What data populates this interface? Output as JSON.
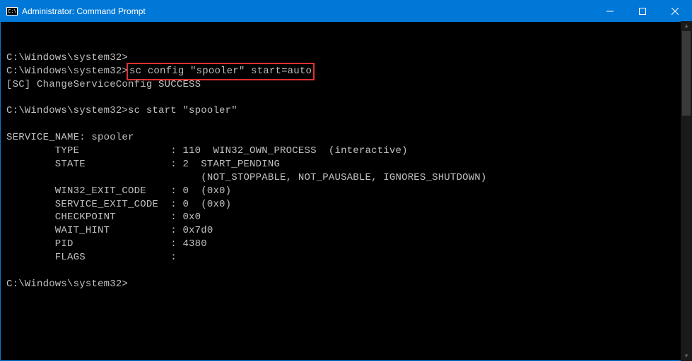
{
  "titlebar": {
    "title": "Administrator: Command Prompt"
  },
  "terminal": {
    "lines": [
      "",
      "C:\\Windows\\system32>"
    ],
    "highlighted_prompt": "C:\\Windows\\system32>",
    "highlighted_command": "sc config \"spooler\" start=auto",
    "result1": "[SC] ChangeServiceConfig SUCCESS",
    "blank1": "",
    "prompt2": "C:\\Windows\\system32>sc start \"spooler\"",
    "blank2": "",
    "service_name": "SERVICE_NAME: spooler",
    "type_line": "        TYPE               : 110  WIN32_OWN_PROCESS  (interactive)",
    "state_line": "        STATE              : 2  START_PENDING",
    "state_line2": "                                (NOT_STOPPABLE, NOT_PAUSABLE, IGNORES_SHUTDOWN)",
    "win32_exit": "        WIN32_EXIT_CODE    : 0  (0x0)",
    "service_exit": "        SERVICE_EXIT_CODE  : 0  (0x0)",
    "checkpoint": "        CHECKPOINT         : 0x0",
    "wait_hint": "        WAIT_HINT          : 0x7d0",
    "pid": "        PID                : 4380",
    "flags": "        FLAGS              :",
    "blank3": "",
    "prompt3": "C:\\Windows\\system32>"
  }
}
